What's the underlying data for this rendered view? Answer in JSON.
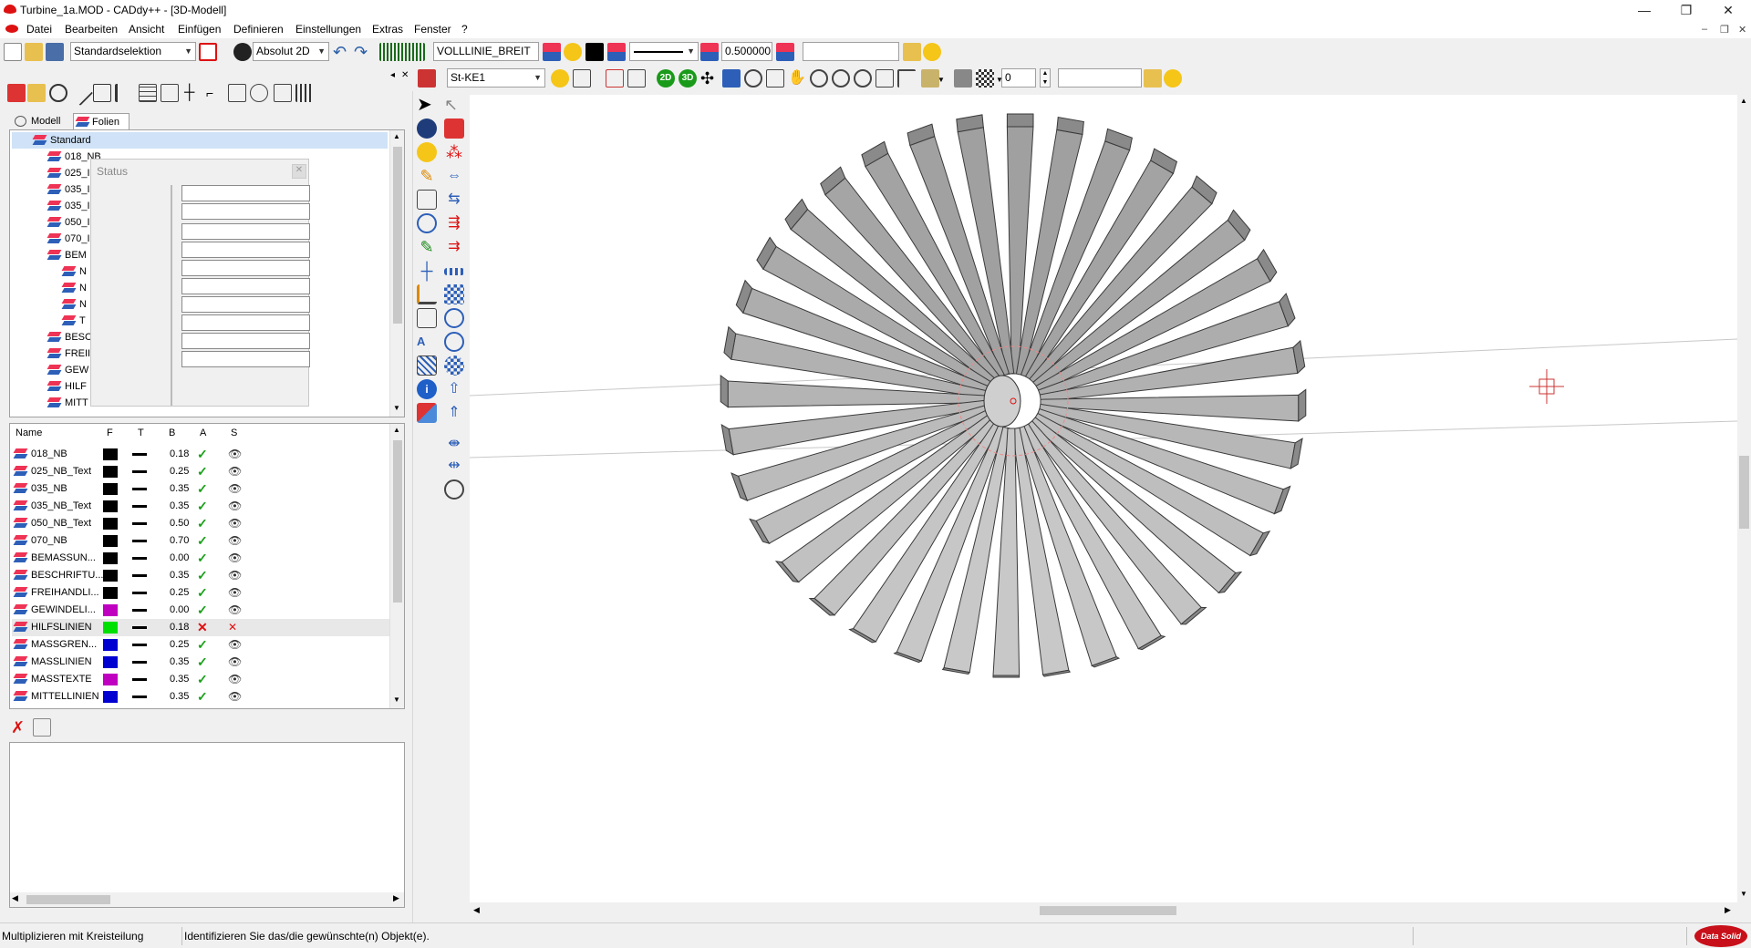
{
  "window": {
    "title": "Turbine_1a.MOD  -  CADdy++ - [3D-Modell]",
    "minimize": "—",
    "restore": "❐",
    "close": "✕"
  },
  "menu": [
    "Datei",
    "Bearbeiten",
    "Ansicht",
    "Einfügen",
    "Definieren",
    "Einstellungen",
    "Extras",
    "Fenster",
    "?"
  ],
  "mdi_controls": {
    "min": "–",
    "restore": "❐",
    "close": "✕"
  },
  "toolbar1": {
    "selection_mode": "Standardselektion",
    "coord_mode": "Absolut 2D",
    "linetype": "VOLLLINIE_BREIT",
    "line_width": "0.500000",
    "search": ""
  },
  "toolbar2": {
    "material": "St-KE1",
    "layer_number": "0",
    "search": "",
    "btn_2d": "2D",
    "btn_3d": "3D"
  },
  "panel_tabs": {
    "model": "Modell",
    "layers": "Folien"
  },
  "tree": {
    "root": "Standard",
    "items": [
      "018_NB",
      "025_I",
      "035_I",
      "035_I",
      "050_I",
      "070_I",
      "BEM",
      "N",
      "N",
      "N",
      "T",
      "BESC",
      "FREII",
      "GEW",
      "HILF",
      "MITT"
    ]
  },
  "status_popup": {
    "label": "Status",
    "close": "✕"
  },
  "layer_table": {
    "headers": {
      "name": "Name",
      "color": "F",
      "type": "T",
      "width": "B",
      "active": "A",
      "visible": "S"
    },
    "rows": [
      {
        "name": "018_NB",
        "color": "#000000",
        "width": "0.18",
        "active": "✓",
        "visible": "👁",
        "active_color": "#1aa01a",
        "visible_color": "#333333"
      },
      {
        "name": "025_NB_Text",
        "color": "#000000",
        "width": "0.25",
        "active": "✓",
        "visible": "👁",
        "active_color": "#1aa01a",
        "visible_color": "#333333"
      },
      {
        "name": "035_NB",
        "color": "#000000",
        "width": "0.35",
        "active": "✓",
        "visible": "👁",
        "active_color": "#1aa01a",
        "visible_color": "#333333"
      },
      {
        "name": "035_NB_Text",
        "color": "#000000",
        "width": "0.35",
        "active": "✓",
        "visible": "👁",
        "active_color": "#1aa01a",
        "visible_color": "#333333"
      },
      {
        "name": "050_NB_Text",
        "color": "#000000",
        "width": "0.50",
        "active": "✓",
        "visible": "👁",
        "active_color": "#1aa01a",
        "visible_color": "#333333"
      },
      {
        "name": "070_NB",
        "color": "#000000",
        "width": "0.70",
        "active": "✓",
        "visible": "👁",
        "active_color": "#1aa01a",
        "visible_color": "#333333"
      },
      {
        "name": "BEMASSUN...",
        "color": "#000000",
        "width": "0.00",
        "active": "✓",
        "visible": "👁",
        "active_color": "#1aa01a",
        "visible_color": "#333333"
      },
      {
        "name": "BESCHRIFTU...",
        "color": "#000000",
        "width": "0.35",
        "active": "✓",
        "visible": "👁",
        "active_color": "#1aa01a",
        "visible_color": "#333333"
      },
      {
        "name": "FREIHANDLI...",
        "color": "#000000",
        "width": "0.25",
        "active": "✓",
        "visible": "👁",
        "active_color": "#1aa01a",
        "visible_color": "#333333"
      },
      {
        "name": "GEWINDELI...",
        "color": "#c000c0",
        "width": "0.00",
        "active": "✓",
        "visible": "👁",
        "active_color": "#1aa01a",
        "visible_color": "#333333"
      },
      {
        "name": "HILFSLINIEN",
        "color": "#00e000",
        "width": "0.18",
        "active": "✕",
        "visible": "✕",
        "active_color": "#e01010",
        "visible_color": "#e01010"
      },
      {
        "name": "MASSGREN...",
        "color": "#0000d0",
        "width": "0.25",
        "active": "✓",
        "visible": "👁",
        "active_color": "#1aa01a",
        "visible_color": "#333333"
      },
      {
        "name": "MASSLINIEN",
        "color": "#0000d0",
        "width": "0.35",
        "active": "✓",
        "visible": "👁",
        "active_color": "#1aa01a",
        "visible_color": "#333333"
      },
      {
        "name": "MASSTEXTE",
        "color": "#c000c0",
        "width": "0.35",
        "active": "✓",
        "visible": "👁",
        "active_color": "#1aa01a",
        "visible_color": "#333333"
      },
      {
        "name": "MITTELLINIEN",
        "color": "#0000d0",
        "width": "0.35",
        "active": "✓",
        "visible": "👁",
        "active_color": "#1aa01a",
        "visible_color": "#333333"
      }
    ]
  },
  "statusbar": {
    "function": "Multiplizieren mit Kreisteilung",
    "prompt": "Identifizieren Sie das/die gewünschte(n) Objekt(e).",
    "brand": "Data Solid"
  },
  "colors": {
    "accent": "#d11a1a",
    "blade": "#b4b4b4",
    "blade_edge": "#3a3a3a"
  }
}
